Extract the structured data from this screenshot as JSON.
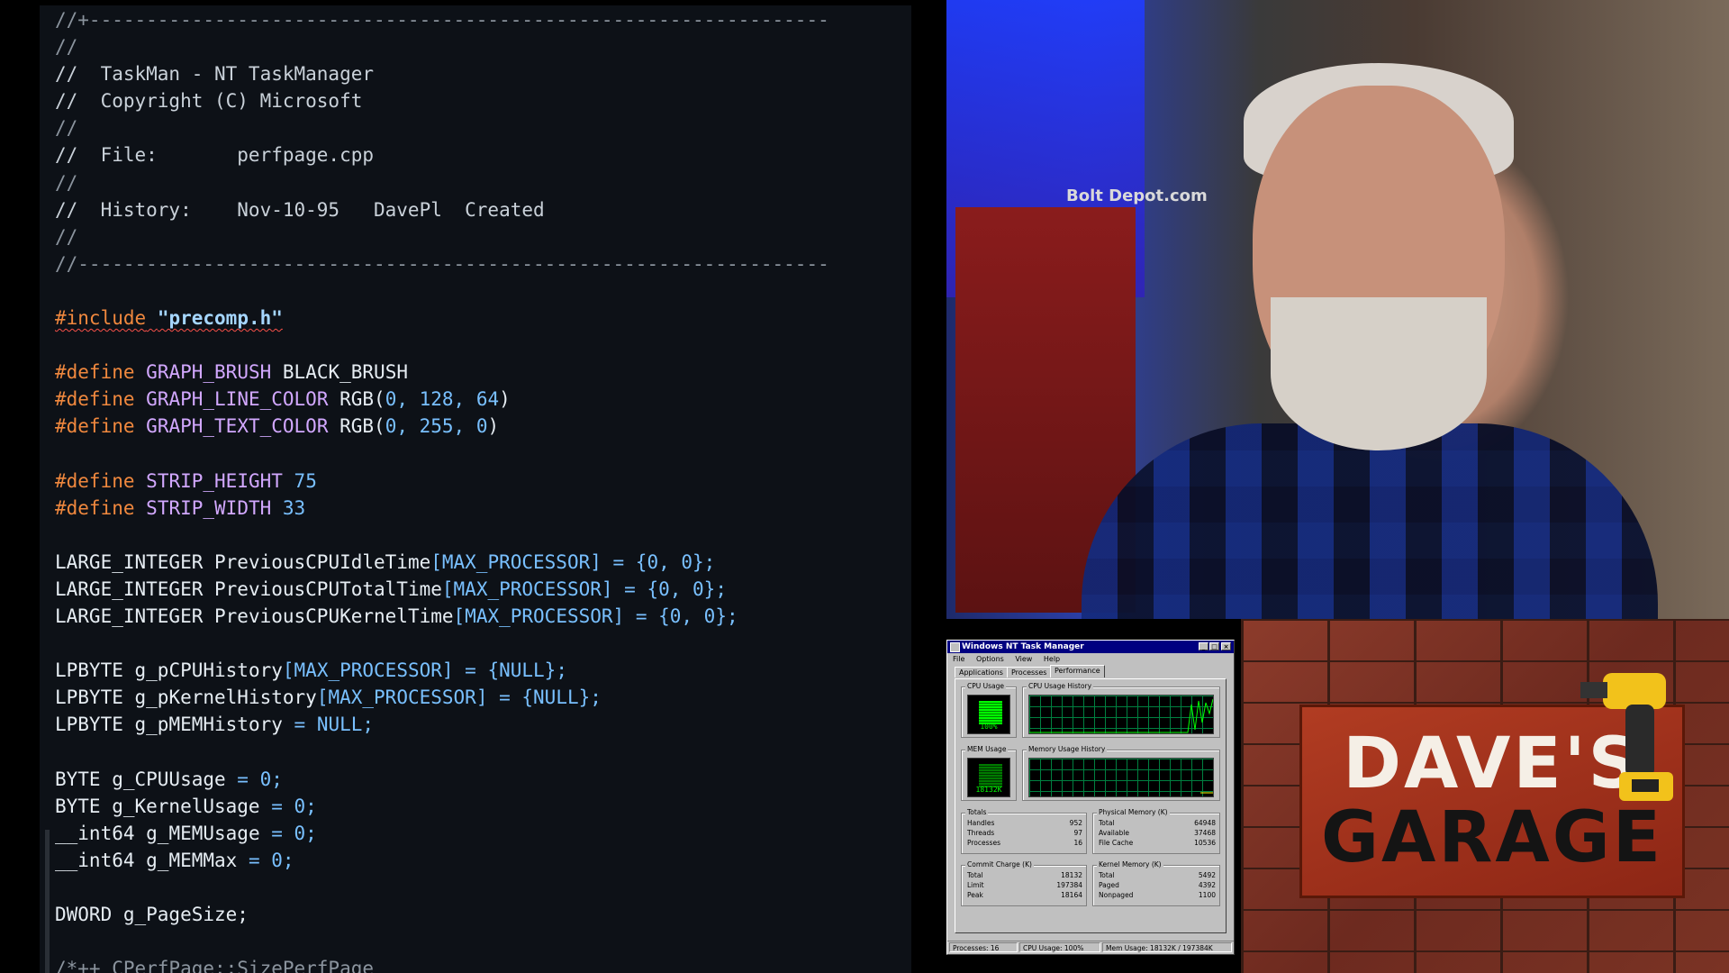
{
  "editor": {
    "comment_lines": [
      "//+-----------------------------------------------------------------",
      "//",
      "//  TaskMan - NT TaskManager",
      "//  Copyright (C) Microsoft",
      "//",
      "//  File:       perfpage.cpp",
      "//",
      "//  History:    Nov-10-95   DavePl  Created",
      "//",
      "//------------------------------------------------------------------"
    ],
    "include_kw": "#include",
    "include_file": "\"precomp.h\"",
    "define_kw": "#define",
    "defines": [
      {
        "name": "GRAPH_BRUSH",
        "value": "BLACK_BRUSH"
      },
      {
        "name": "GRAPH_LINE_COLOR",
        "fn": "RGB(",
        "args": "0, 128, 64",
        "close": ")"
      },
      {
        "name": "GRAPH_TEXT_COLOR",
        "fn": "RGB(",
        "args": "0, 255, 0",
        "close": ")"
      },
      {
        "name": "STRIP_HEIGHT",
        "num": "75"
      },
      {
        "name": "STRIP_WIDTH",
        "num": "33"
      }
    ],
    "globals": [
      {
        "type": "LARGE_INTEGER ",
        "name": "PreviousCPUIdleTime",
        "rest": "[MAX_PROCESSOR] = {0, 0};"
      },
      {
        "type": "LARGE_INTEGER ",
        "name": "PreviousCPUTotalTime",
        "rest": "[MAX_PROCESSOR] = {0, 0};"
      },
      {
        "type": "LARGE_INTEGER ",
        "name": "PreviousCPUKernelTime",
        "rest": "[MAX_PROCESSOR] = {0, 0};"
      },
      {
        "type": "LPBYTE ",
        "name": "g_pCPUHistory",
        "rest": "[MAX_PROCESSOR] = {NULL};"
      },
      {
        "type": "LPBYTE ",
        "name": "g_pKernelHistory",
        "rest": "[MAX_PROCESSOR] = {NULL};"
      },
      {
        "type": "LPBYTE ",
        "name": "g_pMEMHistory",
        "rest": " = NULL;"
      },
      {
        "type": "BYTE ",
        "name": "g_CPUUsage",
        "rest": " = 0;"
      },
      {
        "type": "BYTE ",
        "name": "g_KernelUsage",
        "rest": " = 0;"
      },
      {
        "type": "__int64 ",
        "name": "g_MEMUsage",
        "rest": " = 0;"
      },
      {
        "type": "__int64 ",
        "name": "g_MEMMax",
        "rest": " = 0;"
      },
      {
        "type": "DWORD ",
        "name": "g_PageSize",
        "rest": ";"
      }
    ],
    "trailing_comment": "/*++ CPerfPage::SizePerfPage"
  },
  "webcam": {
    "sign_text": "Bolt Depot.com"
  },
  "taskman": {
    "title": "Windows NT Task Manager",
    "menu": [
      "File",
      "Options",
      "View",
      "Help"
    ],
    "tabs": [
      "Applications",
      "Processes",
      "Performance"
    ],
    "active_tab": "Performance",
    "cpu_usage_label": "CPU Usage",
    "cpu_usage_value": "100%",
    "cpu_history_label": "CPU Usage History",
    "mem_usage_label": "MEM Usage",
    "mem_usage_value": "18132K",
    "mem_history_label": "Memory Usage History",
    "totals": {
      "label": "Totals",
      "rows": [
        [
          "Handles",
          "952"
        ],
        [
          "Threads",
          "97"
        ],
        [
          "Processes",
          "16"
        ]
      ]
    },
    "physical": {
      "label": "Physical Memory (K)",
      "rows": [
        [
          "Total",
          "64948"
        ],
        [
          "Available",
          "37468"
        ],
        [
          "File Cache",
          "10536"
        ]
      ]
    },
    "commit": {
      "label": "Commit Charge (K)",
      "rows": [
        [
          "Total",
          "18132"
        ],
        [
          "Limit",
          "197384"
        ],
        [
          "Peak",
          "18164"
        ]
      ]
    },
    "kernel": {
      "label": "Kernel Memory (K)",
      "rows": [
        [
          "Total",
          "5492"
        ],
        [
          "Paged",
          "4392"
        ],
        [
          "Nonpaged",
          "1100"
        ]
      ]
    },
    "status": [
      "Processes: 16",
      "CPU Usage: 100%",
      "Mem Usage: 18132K / 197384K"
    ]
  },
  "brand": {
    "line1": "DAVE'S",
    "line2": "GARAGE"
  },
  "colors": {
    "preprocessor": "#f0883e",
    "macro": "#d2a8ff",
    "number": "#79c0ff",
    "titlebar": "#000080",
    "graph_green": "#00ff00"
  }
}
